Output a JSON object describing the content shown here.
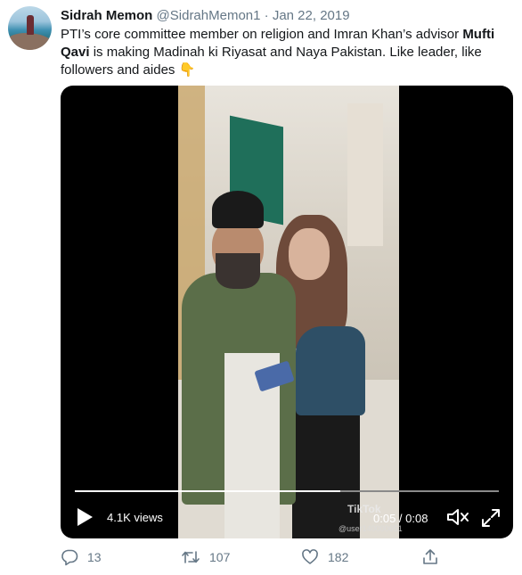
{
  "tweet": {
    "author_name": "Sidrah Memon",
    "handle": "@SidrahMemon1",
    "separator": "·",
    "date": "Jan 22, 2019",
    "text": {
      "part1": "PTI’s core committee member on religion and Imran Khan’s advisor ",
      "bold1": "Mufti Qavi",
      "part2": " is making Madinah ki Riyasat and Naya Pakistan. Like leader, like followers and aides ",
      "emoji": "👇"
    }
  },
  "video": {
    "views": "4.1K views",
    "time": "0:05 / 0:08",
    "progress": 0.625,
    "watermark": "TikTok",
    "watermark_user": "@user140000651"
  },
  "actions": {
    "reply_count": "13",
    "retweet_count": "107",
    "like_count": "182"
  },
  "icons": {
    "reply": "reply-icon",
    "retweet": "retweet-icon",
    "like": "heart-icon",
    "share": "share-icon",
    "play": "play-icon",
    "volume": "volume-icon",
    "fullscreen": "fullscreen-icon"
  },
  "colors": {
    "text": "#14171a",
    "muted": "#657786",
    "video_bg": "#000000"
  }
}
